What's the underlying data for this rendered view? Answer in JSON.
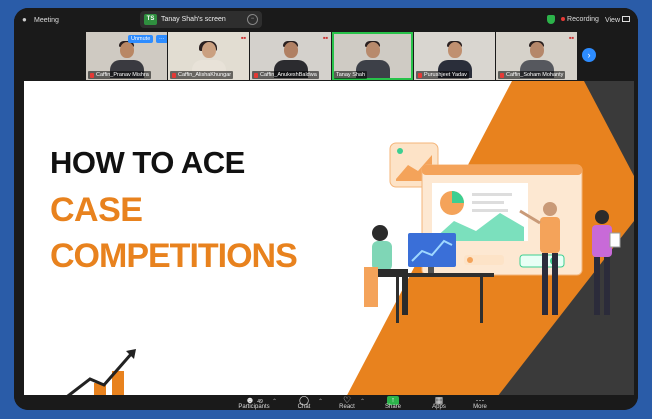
{
  "topbar": {
    "app_label": "Meeting",
    "share_badge": "TS",
    "share_label": "Tanay Shah's screen",
    "recording_label": "Recording",
    "view_label": "View"
  },
  "participants": [
    {
      "name": "Caffin_Pranav Mishra",
      "muted": true,
      "unmute_label": "Unmute",
      "more_label": "···"
    },
    {
      "name": "Caffin_AlishaKhungar",
      "muted": true
    },
    {
      "name": "Caffin_AnukeshBaldwa",
      "muted": true
    },
    {
      "name": "Tanay Shah",
      "muted": false,
      "active": true
    },
    {
      "name": "Purushjeet Yadav",
      "muted": true
    },
    {
      "name": "Caffin_Soham Mohanty",
      "muted": true
    }
  ],
  "slide": {
    "title_line1": "HOW TO ACE",
    "title_line2": "CASE",
    "title_line3": "COMPETITIONS",
    "accent_color": "#e8821e",
    "dark_shape_color": "#3a3a3a"
  },
  "toolbar": {
    "participants_label": "Participants",
    "participants_count": "49",
    "chat_label": "Chat",
    "react_label": "React",
    "share_label": "Share",
    "apps_label": "Apps",
    "more_label": "More"
  },
  "colors": {
    "frame_bg": "#1a1a1a",
    "outer_bg": "#2a5ca8",
    "zoom_blue": "#2d8cff",
    "active_green": "#28c24a",
    "share_green": "#2cb34a"
  }
}
